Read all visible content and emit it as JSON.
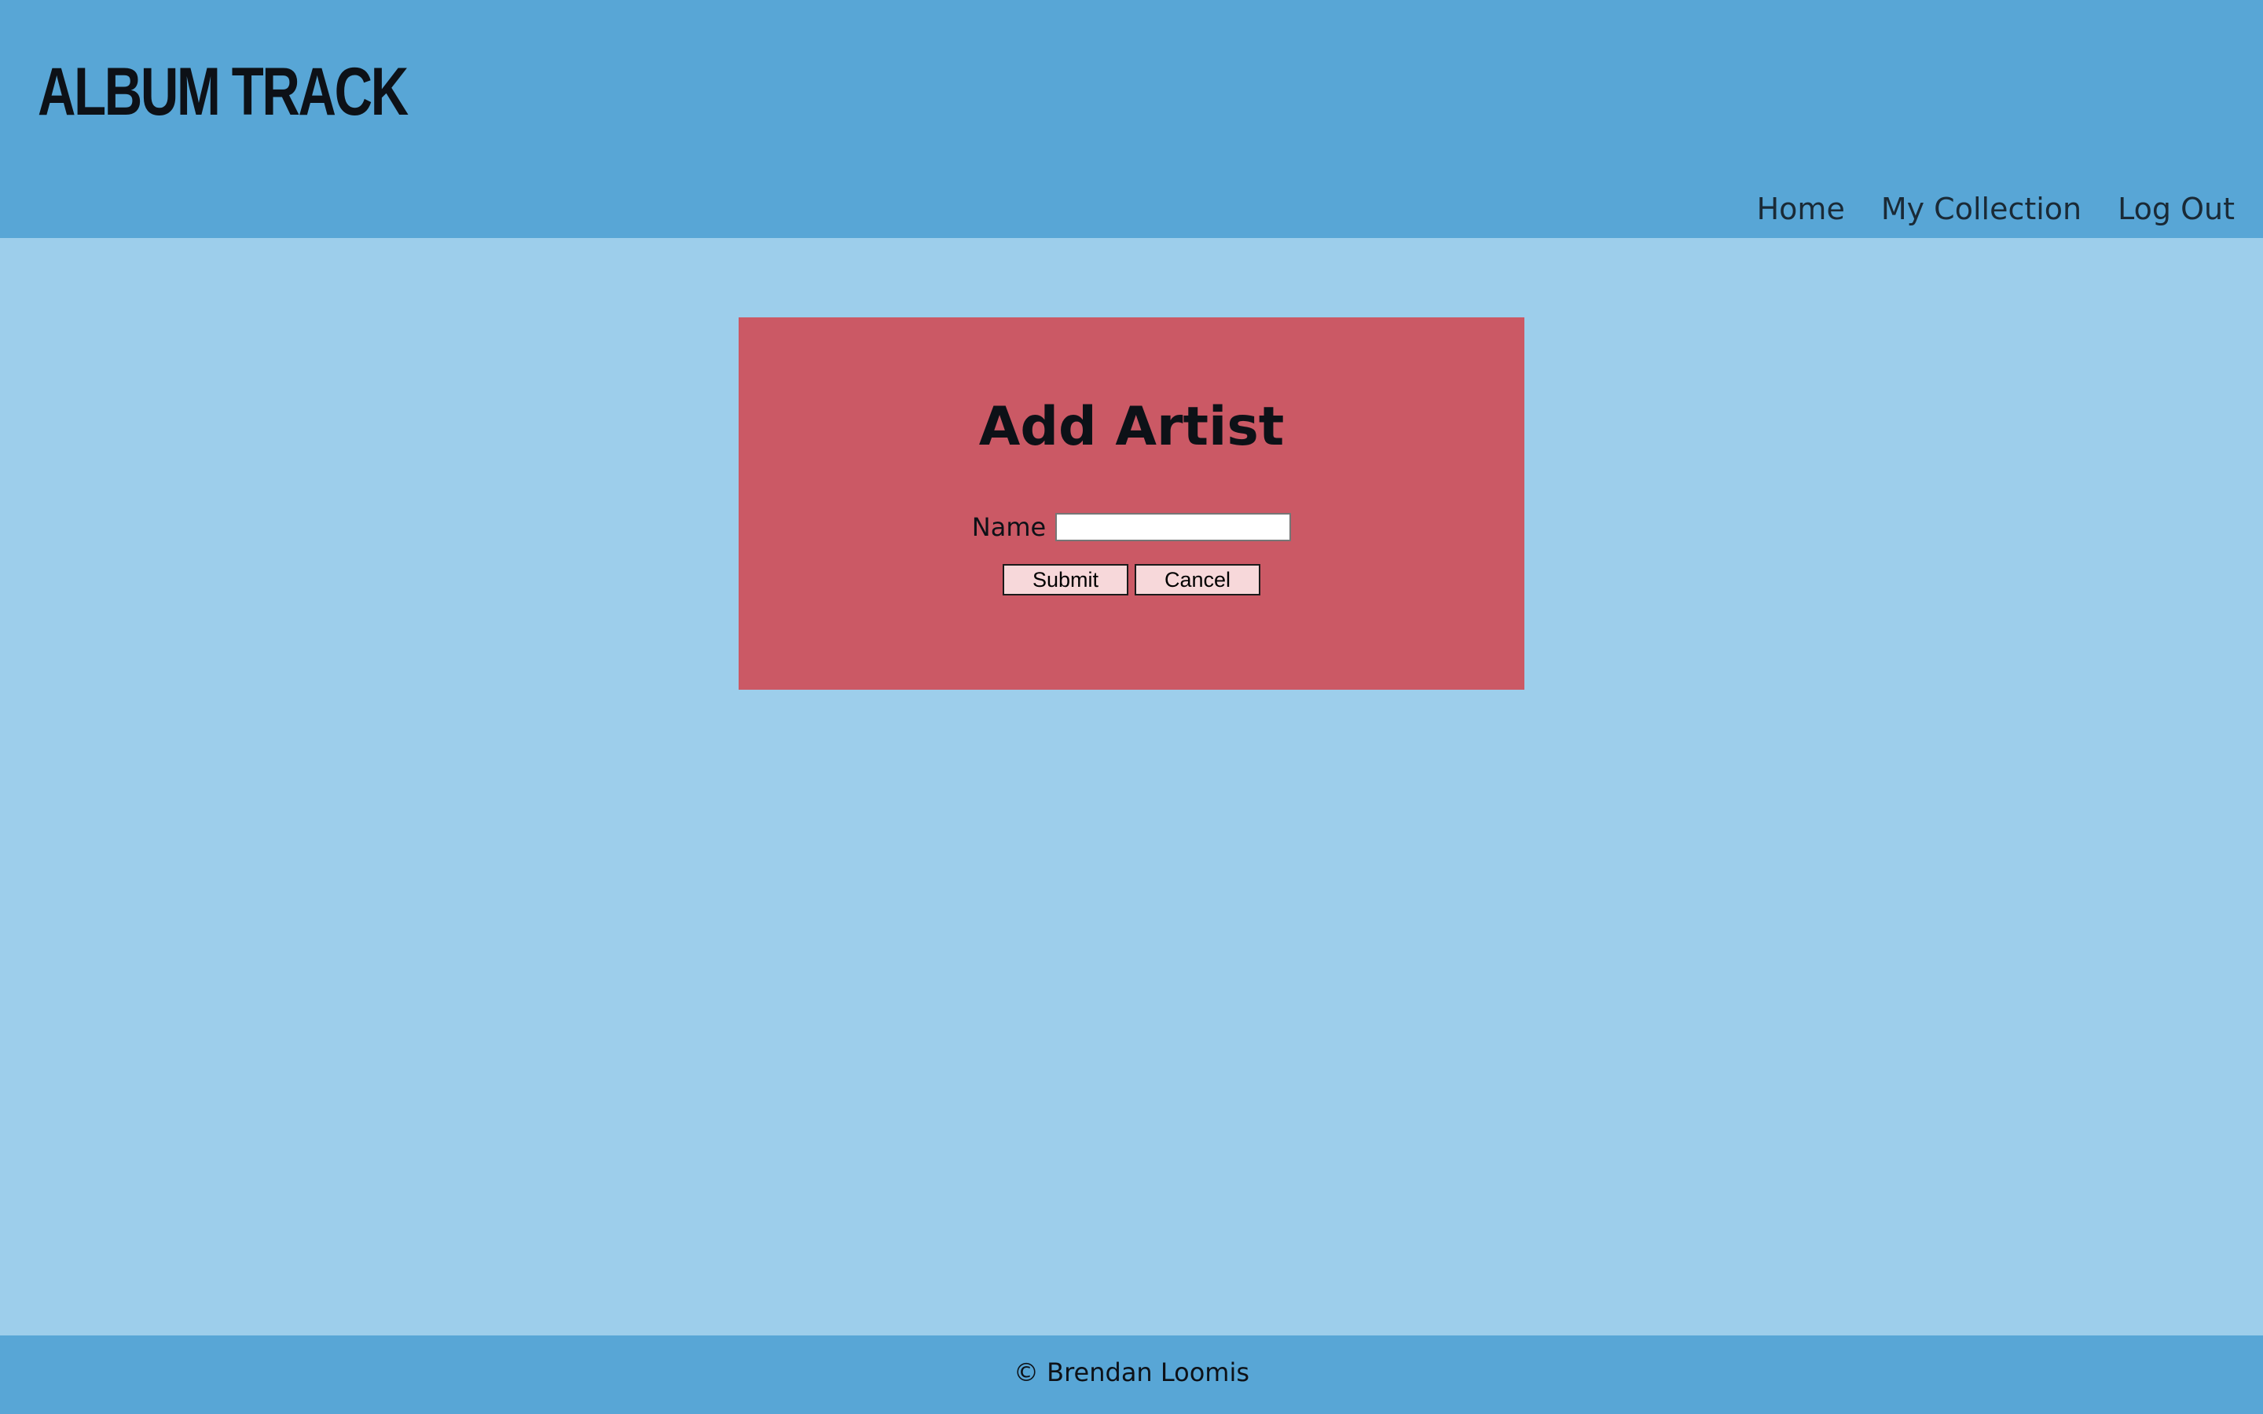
{
  "header": {
    "logo": "ALBUM TRACK",
    "nav": [
      {
        "label": "Home"
      },
      {
        "label": "My Collection"
      },
      {
        "label": "Log Out"
      }
    ]
  },
  "form": {
    "title": "Add Artist",
    "name_label": "Name",
    "name_value": "",
    "submit_label": "Submit",
    "cancel_label": "Cancel"
  },
  "footer": {
    "text": "© Brendan Loomis"
  },
  "colors": {
    "header_bg": "#58a6d6",
    "page_bg": "#9dceeb",
    "card_bg": "#cb5965",
    "button_bg": "#f7d8da"
  }
}
